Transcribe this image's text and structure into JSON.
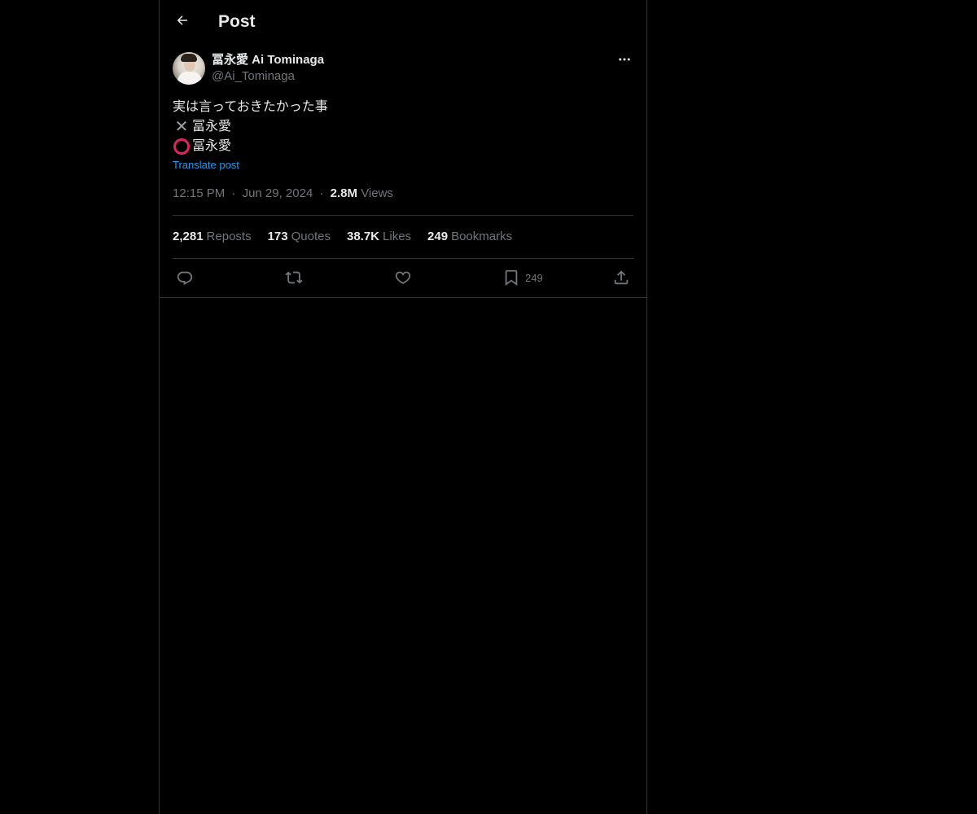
{
  "header": {
    "title": "Post"
  },
  "post": {
    "author": {
      "display_name": "冨永愛 Ai Tominaga",
      "handle": "@Ai_Tominaga"
    },
    "text_lines": [
      "実は言っておきたかった事",
      "冨永愛",
      "冨永愛"
    ],
    "line_marks": [
      "",
      "cross-mark",
      "hollow-red-circle"
    ],
    "translate_label": "Translate post",
    "time": "12:15 PM",
    "separator": "·",
    "date": "Jun 29, 2024",
    "views_count": "2.8M",
    "views_label": "Views"
  },
  "stats": {
    "reposts": {
      "count": "2,281",
      "label": "Reposts"
    },
    "quotes": {
      "count": "173",
      "label": "Quotes"
    },
    "likes": {
      "count": "38.7K",
      "label": "Likes"
    },
    "bookmarks": {
      "count": "249",
      "label": "Bookmarks"
    }
  },
  "actions": {
    "bookmark_count": "249"
  },
  "icons": {
    "back": "arrow-left-icon",
    "more": "more-horizontal-icon",
    "reply": "reply-icon",
    "repost": "repost-icon",
    "like": "heart-icon",
    "bookmark": "bookmark-icon",
    "share": "share-icon"
  },
  "colors": {
    "background": "#000000",
    "border": "#2f3336",
    "text_primary": "#e7e9ea",
    "text_secondary": "#71767b",
    "link": "#1d9bf0",
    "circle_mark": "#e0245e"
  }
}
